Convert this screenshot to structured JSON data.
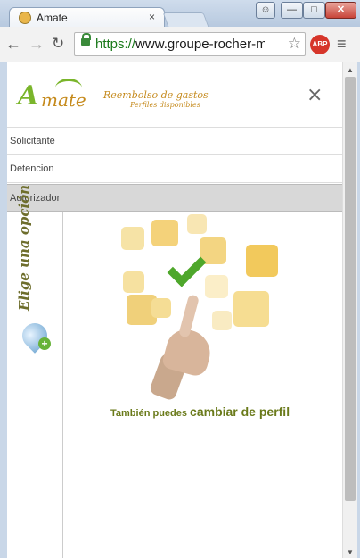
{
  "browser": {
    "tab_title": "Amate",
    "tab_close": "×",
    "url_scheme": "https://",
    "url_rest": "www.groupe-rocher-mexic",
    "abp_label": "ABP"
  },
  "app": {
    "logo_a": "A",
    "logo_rest": "mate",
    "subtitle_main": "Reembolso de gastos",
    "subtitle_sub": "Perfiles disponibles",
    "close_label": "×"
  },
  "menu": {
    "items": [
      {
        "label": "Solicitante"
      },
      {
        "label": "Detencion"
      },
      {
        "label": "Autorizador"
      }
    ]
  },
  "side": {
    "text": "Elige una opción"
  },
  "caption": {
    "small": "También puedes ",
    "big": "cambiar de perfil"
  }
}
